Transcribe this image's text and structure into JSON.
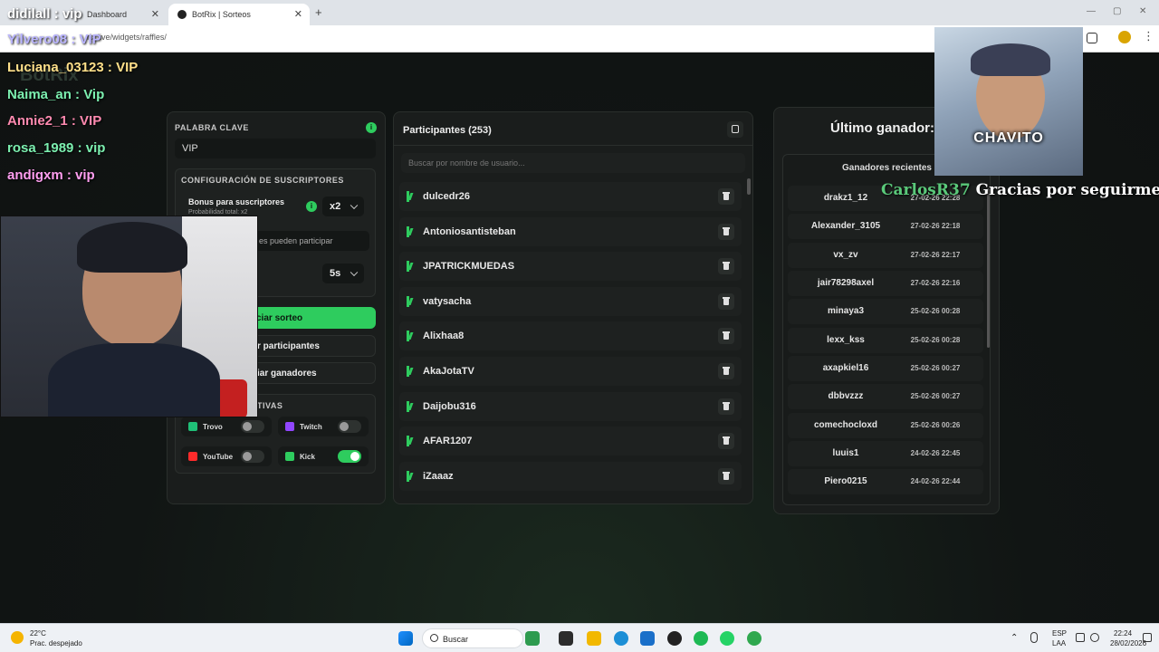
{
  "browser": {
    "tabs": [
      {
        "title": "Dashboard"
      },
      {
        "title": "BotRix | Sorteos"
      }
    ],
    "new_tab": "+",
    "url": "rix.live/widgets/raffles/"
  },
  "app": {
    "brand": "BotRix"
  },
  "left_panel": {
    "keyword_label": "PALABRA CLAVE",
    "keyword_value": "VIP",
    "subs_config_label": "CONFIGURACIÓN DE SUSCRIPTORES",
    "bonus_label": "Bonus para suscriptores",
    "bonus_sub": "Probabilidad total: x2",
    "bonus_value": "x2",
    "subs_only_text": "es pueden participar",
    "timer_value": "5s",
    "start_button": "ciar sorteo",
    "clear_participants_button": "r participantes",
    "clear_winners_button": "iar ganadores",
    "platforms_label": "TIVAS",
    "platforms": [
      {
        "name": "Trovo",
        "enabled": false,
        "color": "#1fbf77"
      },
      {
        "name": "Twitch",
        "enabled": false,
        "color": "#9146ff"
      },
      {
        "name": "YouTube",
        "enabled": false,
        "color": "#ff2b2b"
      },
      {
        "name": "Kick",
        "enabled": true,
        "color": "#2ecc5e"
      }
    ]
  },
  "participants": {
    "title": "Participantes (253)",
    "search_placeholder": "Buscar por nombre de usuario...",
    "rows": [
      "dulcedr26",
      "Antoniosantisteban",
      "JPATRICKMUEDAS",
      "vatysacha",
      "Alixhaa8",
      "AkaJotaTV",
      "Daijobu316",
      "AFAR1207",
      "iZaaaz"
    ]
  },
  "winners": {
    "title": "Último ganador:",
    "recent_label": "Ganadores recientes",
    "rows": [
      {
        "name": "drakz1_12",
        "date": "27-02-26 22:28"
      },
      {
        "name": "Alexander_3105",
        "date": "27-02-26 22:18"
      },
      {
        "name": "vx_zv",
        "date": "27-02-26 22:17"
      },
      {
        "name": "jair78298axel",
        "date": "27-02-26 22:16"
      },
      {
        "name": "minaya3",
        "date": "25-02-26 00:28"
      },
      {
        "name": "lexx_kss",
        "date": "25-02-26 00:28"
      },
      {
        "name": "axapkiel16",
        "date": "25-02-26 00:27"
      },
      {
        "name": "dbbvzzz",
        "date": "25-02-26 00:27"
      },
      {
        "name": "comechocloxd",
        "date": "25-02-26 00:26"
      },
      {
        "name": "luuis1",
        "date": "24-02-26 22:45"
      },
      {
        "name": "Piero0215",
        "date": "24-02-26 22:44"
      }
    ]
  },
  "stream_overlay": {
    "chat": [
      {
        "text": "didilall : vip",
        "color": "#ffffff"
      },
      {
        "text": "Yilvero08 : VIP",
        "color": "#b9b4ff"
      },
      {
        "text": "Luciana_03123 : VIP",
        "color": "#ffe08a"
      },
      {
        "text": "Naima_an : Vip",
        "color": "#7cf0b0"
      },
      {
        "text": "Annie2_1 : VIP",
        "color": "#ff8ab0"
      },
      {
        "text": "rosa_1989 : vip",
        "color": "#7cf0b0"
      },
      {
        "text": "andigxm : vip",
        "color": "#ff9ef0"
      }
    ],
    "alert_name": "CHAVITO",
    "follow_user": "CarlosR37",
    "follow_text": "Gracias por seguirme!!"
  },
  "taskbar": {
    "weather_temp": "22°C",
    "weather_desc": "Prac. despejado",
    "search_label": "Buscar",
    "lang_top": "ESP",
    "lang_bottom": "LAA",
    "time": "22:24",
    "date": "28/02/2026"
  }
}
